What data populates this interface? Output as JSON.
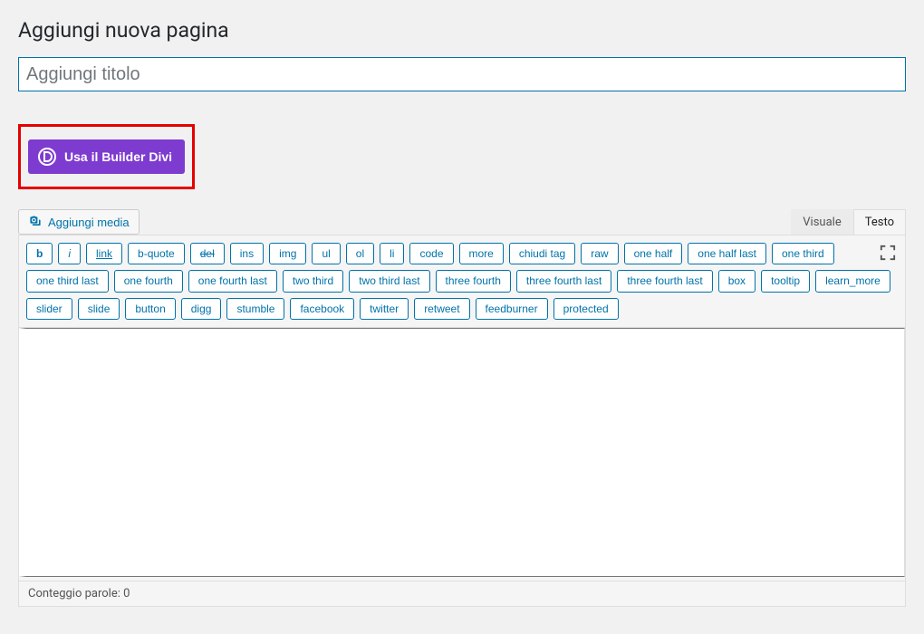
{
  "header": {
    "title": "Aggiungi nuova pagina"
  },
  "title_field": {
    "placeholder": "Aggiungi titolo",
    "value": ""
  },
  "divi": {
    "button_label": "Usa il Builder Divi"
  },
  "media": {
    "button_label": "Aggiungi media"
  },
  "editor_tabs": {
    "visual": "Visuale",
    "text": "Testo",
    "active": "text"
  },
  "quicktags": {
    "b": "b",
    "i": "i",
    "link": "link",
    "bquote": "b-quote",
    "del": "del",
    "ins": "ins",
    "img": "img",
    "ul": "ul",
    "ol": "ol",
    "li": "li",
    "code": "code",
    "more": "more",
    "close": "chiudi tag",
    "raw": "raw",
    "one_half": "one half",
    "one_half_last": "one half last",
    "one_third": "one third",
    "one_third_last": "one third last",
    "one_fourth": "one fourth",
    "one_fourth_last": "one fourth last",
    "two_third": "two third",
    "two_third_last": "two third last",
    "three_fourth": "three fourth",
    "three_fourth_last": "three fourth last",
    "three_fourth_last2": "three fourth last",
    "box": "box",
    "tooltip": "tooltip",
    "learn_more": "learn_more",
    "slider": "slider",
    "slide": "slide",
    "button": "button",
    "digg": "digg",
    "stumble": "stumble",
    "facebook": "facebook",
    "twitter": "twitter",
    "retweet": "retweet",
    "feedburner": "feedburner",
    "protected": "protected"
  },
  "status_bar": {
    "word_count_label": "Conteggio parole: 0"
  }
}
